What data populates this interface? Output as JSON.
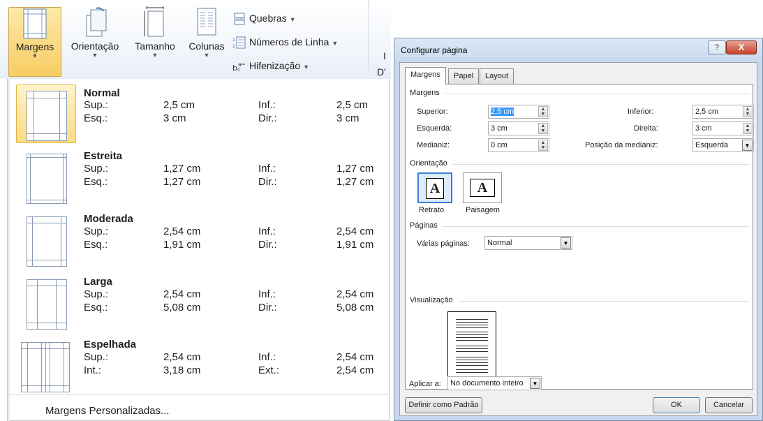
{
  "ribbon": {
    "margens": "Margens",
    "orientacao": "Orientação",
    "tamanho": "Tamanho",
    "colunas": "Colunas",
    "quebras": "Quebras",
    "numeros_linha": "Números de Linha",
    "hifenizacao": "Hifenização",
    "cut_a": "I",
    "cut_b": "D'"
  },
  "gallery": {
    "items": [
      {
        "name": "Normal",
        "r1": [
          "Sup.:",
          "2,5 cm",
          "Inf.:",
          "2,5 cm"
        ],
        "r2": [
          "Esq.:",
          "3 cm",
          "Dir.:",
          "3 cm"
        ]
      },
      {
        "name": "Estreita",
        "r1": [
          "Sup.:",
          "1,27 cm",
          "Inf.:",
          "1,27 cm"
        ],
        "r2": [
          "Esq.:",
          "1,27 cm",
          "Dir.:",
          "1,27 cm"
        ]
      },
      {
        "name": "Moderada",
        "r1": [
          "Sup.:",
          "2,54 cm",
          "Inf.:",
          "2,54 cm"
        ],
        "r2": [
          "Esq.:",
          "1,91 cm",
          "Dir.:",
          "1,91 cm"
        ]
      },
      {
        "name": "Larga",
        "r1": [
          "Sup.:",
          "2,54 cm",
          "Inf.:",
          "2,54 cm"
        ],
        "r2": [
          "Esq.:",
          "5,08 cm",
          "Dir.:",
          "5,08 cm"
        ]
      },
      {
        "name": "Espelhada",
        "r1": [
          "Sup.:",
          "2,54 cm",
          "Inf.:",
          "2,54 cm"
        ],
        "r2": [
          "Int.:",
          "3,18 cm",
          "Ext.:",
          "2,54 cm"
        ]
      }
    ],
    "custom": "Margens Personalizadas..."
  },
  "dialog": {
    "title": "Configurar página",
    "help": "?",
    "close": "X",
    "tabs": [
      "Margens",
      "Papel",
      "Layout"
    ],
    "margens_group": "Margens",
    "superior_label": "Superior:",
    "superior": "2,5 cm",
    "inferior_label": "Inferior:",
    "inferior": "2,5 cm",
    "esquerda_label": "Esquerda:",
    "esquerda": "3 cm",
    "direita_label": "Direita:",
    "direita": "3 cm",
    "medianiz_label": "Medianiz:",
    "medianiz": "0 cm",
    "posicao_label": "Posição da medianiz:",
    "posicao": "Esquerda",
    "orientacao_group": "Orientação",
    "retrato": "Retrato",
    "paisagem": "Paisagem",
    "paginas_group": "Páginas",
    "varias_label": "Várias páginas:",
    "varias": "Normal",
    "visualizacao_group": "Visualização",
    "aplicar_label": "Aplicar a:",
    "aplicar": "No documento inteiro",
    "definir": "Definir como Padrão",
    "ok": "OK",
    "cancelar": "Cancelar"
  }
}
